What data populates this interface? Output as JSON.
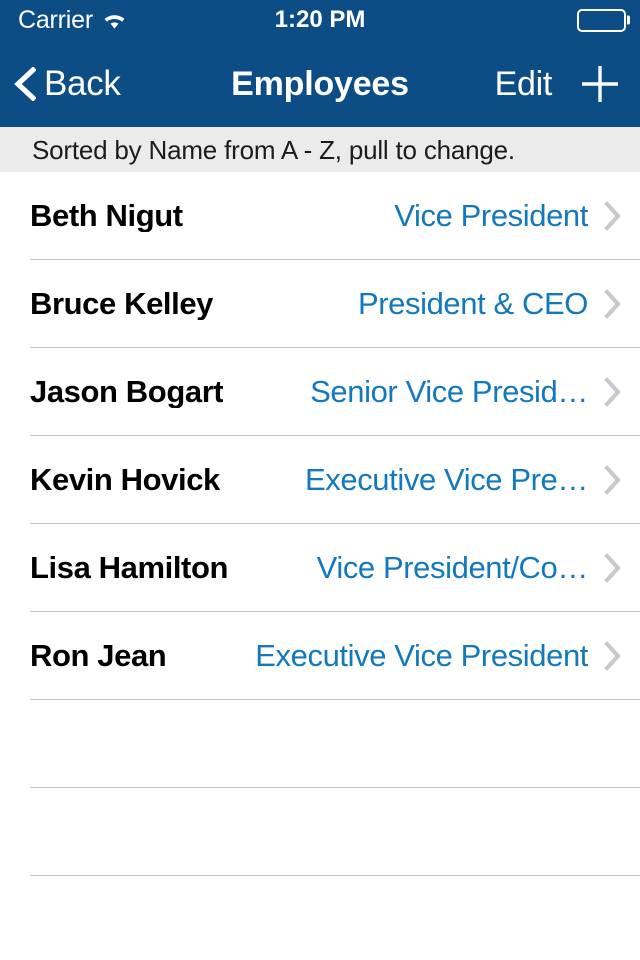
{
  "status_bar": {
    "carrier": "Carrier",
    "wifi_icon": "wifi-icon",
    "time": "1:20 PM",
    "battery_icon": "battery-icon"
  },
  "nav_bar": {
    "back_icon": "chevron-left-icon",
    "back_label": "Back",
    "title": "Employees",
    "edit_label": "Edit",
    "add_icon": "plus-icon"
  },
  "sort_header": {
    "text": "Sorted by Name from A - Z, pull to change."
  },
  "list": {
    "disclosure_icon": "chevron-right-icon",
    "rows": [
      {
        "name": "Beth Nigut",
        "title": "Vice President"
      },
      {
        "name": "Bruce Kelley",
        "title": "President & CEO"
      },
      {
        "name": "Jason Bogart",
        "title": "Senior Vice Presid…"
      },
      {
        "name": "Kevin Hovick",
        "title": "Executive Vice Pre…"
      },
      {
        "name": "Lisa Hamilton",
        "title": "Vice President/Co…"
      },
      {
        "name": "Ron Jean",
        "title": "Executive Vice President"
      }
    ],
    "empty_row_count": 3
  },
  "colors": {
    "nav_bar_background": "#0d4d85",
    "sort_header_background": "#ebebeb",
    "detail_text": "#1279bd",
    "name_text": "#000000",
    "separator": "#c4c4c6",
    "chevron": "#c7c7cc"
  }
}
